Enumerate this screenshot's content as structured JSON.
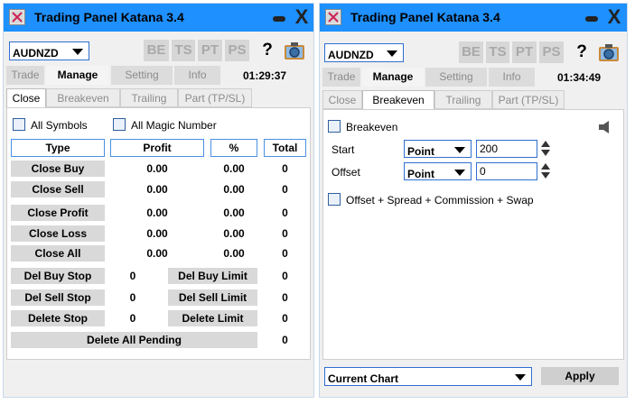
{
  "colors": {
    "titlebar": "#1e90ff",
    "button_bg": "#d9d9d9",
    "border_accent": "#4a90e2"
  },
  "left_panel": {
    "title": "Trading Panel Katana 3.4",
    "icons": {
      "app": "app-x-icon",
      "minimize": "minimize-icon",
      "close": "close-icon"
    },
    "close_glyph": "X",
    "symbol": "AUDNZD",
    "tools": {
      "be": "BE",
      "ts": "TS",
      "pt": "PT",
      "ps": "PS",
      "help": "?"
    },
    "main_tabs": [
      "Trade",
      "Manage",
      "Setting",
      "Info"
    ],
    "clock": "01:29:37",
    "sub_tabs": [
      "Close",
      "Breakeven",
      "Trailing",
      "Part (TP/SL)"
    ],
    "all_symbols_label": "All Symbols",
    "all_magic_label": "All Magic Number",
    "headers": {
      "type": "Type",
      "profit": "Profit",
      "percent": "%",
      "total": "Total"
    },
    "rows": [
      {
        "label": "Close Buy",
        "profit": "0.00",
        "percent": "0.00",
        "total": "0"
      },
      {
        "label": "Close Sell",
        "profit": "0.00",
        "percent": "0.00",
        "total": "0"
      },
      {
        "label": "Close Profit",
        "profit": "0.00",
        "percent": "0.00",
        "total": "0"
      },
      {
        "label": "Close Loss",
        "profit": "0.00",
        "percent": "0.00",
        "total": "0"
      },
      {
        "label": "Close All",
        "profit": "0.00",
        "percent": "0.00",
        "total": "0"
      }
    ],
    "pending_rows": [
      {
        "left_label": "Del Buy Stop",
        "left_value": "0",
        "right_label": "Del Buy Limit",
        "right_value": "0"
      },
      {
        "left_label": "Del Sell Stop",
        "left_value": "0",
        "right_label": "Del Sell Limit",
        "right_value": "0"
      },
      {
        "left_label": "Delete Stop",
        "left_value": "0",
        "right_label": "Delete Limit",
        "right_value": "0"
      }
    ],
    "delete_all_label": "Delete All Pending",
    "delete_all_value": "0"
  },
  "right_panel": {
    "title": "Trading Panel Katana 3.4",
    "close_glyph": "X",
    "symbol": "AUDNZD",
    "tools": {
      "be": "BE",
      "ts": "TS",
      "pt": "PT",
      "ps": "PS",
      "help": "?"
    },
    "main_tabs": [
      "Trade",
      "Manage",
      "Setting",
      "Info"
    ],
    "clock": "01:34:49",
    "sub_tabs": [
      "Close",
      "Breakeven",
      "Trailing",
      "Part (TP/SL)"
    ],
    "breakeven_label": "Breakeven",
    "start_label": "Start",
    "start_mode": "Point",
    "start_value": "200",
    "offset_label": "Offset",
    "offset_mode": "Point",
    "offset_value": "0",
    "offset_option_label": "Offset + Spread + Commission + Swap",
    "chart_scope": "Current Chart",
    "apply_label": "Apply"
  }
}
